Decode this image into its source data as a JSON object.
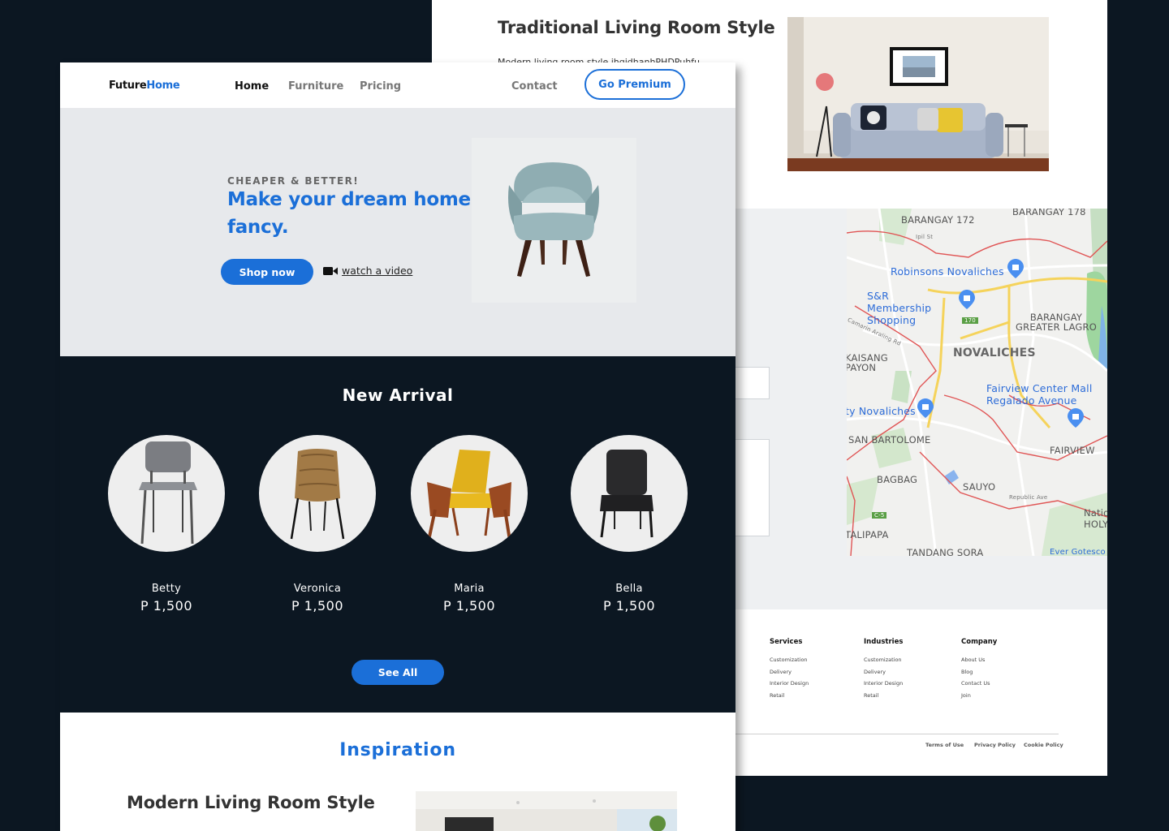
{
  "back": {
    "heading": "Traditional Living Room Style",
    "description": "Modern living room style jhgjdhanhPHDPuhfu",
    "map": {
      "places": [
        "BARANGAY 172",
        "BARANGAY 178",
        "Ipil St",
        "Robinsons Novaliches",
        "S&R Membership Shopping",
        "BARANGAY GREATER LAGRO",
        "NOVALICHES",
        "Camarin Araling Rd",
        "KAISANG PAYON",
        "Fairview Center Mall",
        "Regalado Avenue",
        "ty Novaliches",
        "SAN BARTOLOME",
        "FAIRVIEW",
        "BAGBAG",
        "SAUYO",
        "Republic Ave",
        "TALIPAPA",
        "TANDANG SORA",
        "Natio HOLY",
        "Ever Gotesco",
        "170",
        "C-5"
      ]
    },
    "footer": {
      "columns": [
        {
          "heading": "Services",
          "links": [
            "Customization",
            "Delivery",
            "Interior Design",
            "Retail"
          ]
        },
        {
          "heading": "Industries",
          "links": [
            "Customization",
            "Delivery",
            "Interior Design",
            "Retail"
          ]
        },
        {
          "heading": "Company",
          "links": [
            "About Us",
            "Blog",
            "Contact Us",
            "Join"
          ]
        }
      ],
      "legal": [
        "Terms of Use",
        "Privacy Policy",
        "Cookie Policy"
      ]
    }
  },
  "front": {
    "brand": {
      "part1": "Future",
      "part2": "Home"
    },
    "nav": {
      "home": "Home",
      "furniture": "Furniture",
      "pricing": "Pricing",
      "contact": "Contact"
    },
    "premium_label": "Go Premium",
    "hero": {
      "eyebrow": "CHEAPER & BETTER!",
      "title": "Make your dream home fancy.",
      "shop_label": "Shop now",
      "video_label": "watch a video"
    },
    "arrivals": {
      "title": "New Arrival",
      "products": [
        {
          "name": "Betty",
          "price": "P 1,500"
        },
        {
          "name": "Veronica",
          "price": "P 1,500"
        },
        {
          "name": "Maria",
          "price": "P 1,500"
        },
        {
          "name": "Bella",
          "price": "P 1,500"
        }
      ],
      "see_all_label": "See All"
    },
    "inspiration": {
      "title": "Inspiration",
      "item_title": "Modern Living Room Style"
    }
  },
  "colors": {
    "accent": "#1b6fd8",
    "dark": "#0c1722",
    "hero_bg": "#e7e9ec"
  },
  "icons": [
    "video-camera-icon",
    "map-pin-icon",
    "shopping-pin-icon"
  ]
}
